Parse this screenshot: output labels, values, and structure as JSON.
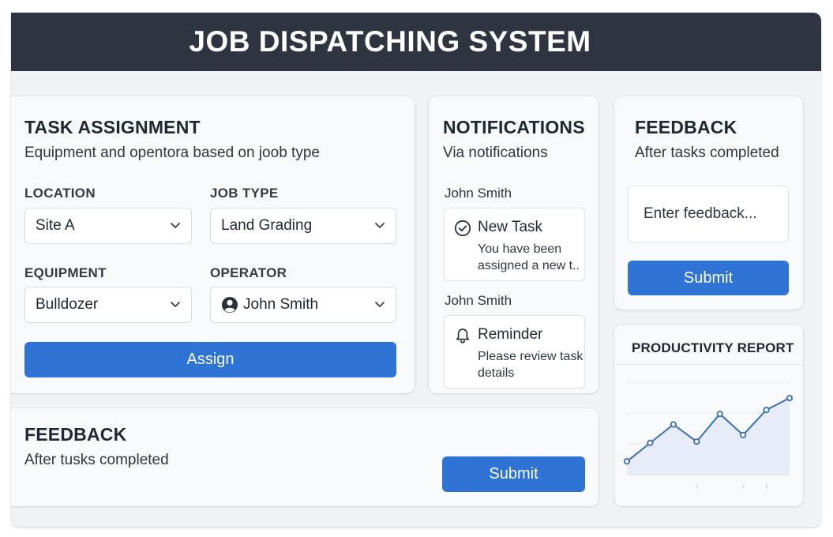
{
  "app": {
    "title": "JOB DISPATCHING SYSTEM"
  },
  "task_assignment": {
    "title": "TASK ASSIGNMENT",
    "subtitle": "Equipment and opentora based on joob type",
    "location": {
      "label": "LOCATION",
      "value": "Site A"
    },
    "job_type": {
      "label": "JOB TYPE",
      "value": "Land Grading"
    },
    "equipment": {
      "label": "EQUIPMENT",
      "value": "Bulldozer"
    },
    "operator": {
      "label": "OPERATOR",
      "value": "John Smith",
      "icon": "person-circle-icon"
    },
    "assign_label": "Assign"
  },
  "notifications": {
    "title": "NOTIFICATIONS",
    "subtitle": "Via notifications",
    "items": [
      {
        "sender": "John Smith",
        "icon": "check-circle-icon",
        "title": "New Task",
        "body": "You have been assigned a new t.."
      },
      {
        "sender": "John Smith",
        "icon": "bell-icon",
        "title": "Reminder",
        "body": "Please review task details"
      }
    ]
  },
  "feedback_side": {
    "title": "FEEDBACK",
    "subtitle": "After tasks completed",
    "placeholder": "Enter feedback...",
    "submit_label": "Submit"
  },
  "feedback_bottom": {
    "title": "FEEDBACK",
    "subtitle": "After tusks completed",
    "submit_label": "Submit"
  },
  "productivity_report": {
    "title": "PRODUCTIVITY REPORT"
  },
  "colors": {
    "header": "#2e3540",
    "accent": "#2f73d4",
    "chart_line": "#3a6fb5",
    "chart_fill": "#e6edf8"
  },
  "chart_data": {
    "type": "area",
    "title": "PRODUCTIVITY REPORT",
    "x": [
      1,
      2,
      3,
      4,
      5,
      6,
      7,
      8
    ],
    "values": [
      1.0,
      2.4,
      3.8,
      2.5,
      4.6,
      3.0,
      4.9,
      5.8
    ],
    "ylim": [
      0,
      7
    ],
    "grid": true
  }
}
